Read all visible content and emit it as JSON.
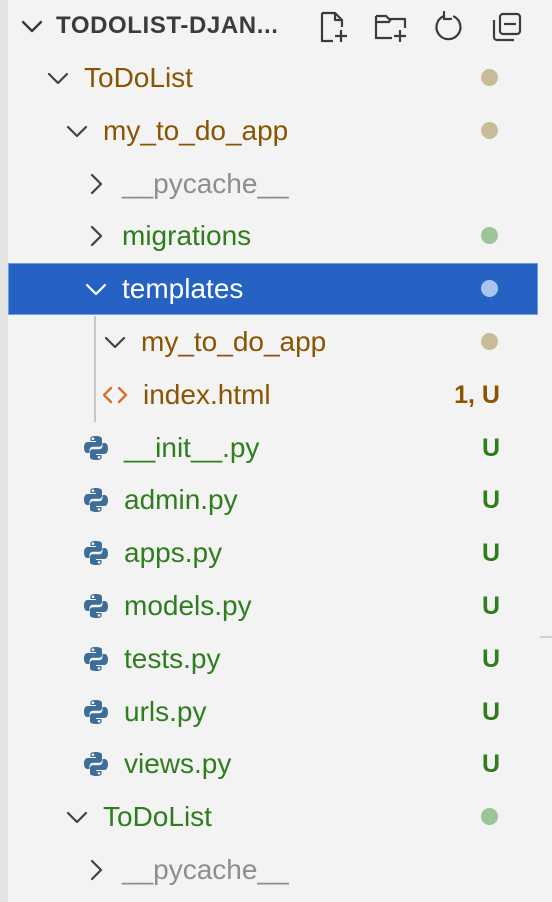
{
  "explorer": {
    "title": "TODOLIST-DJAN...",
    "actions": [
      {
        "name": "new-file",
        "icon": "new-file-icon"
      },
      {
        "name": "new-folder",
        "icon": "new-folder-icon"
      },
      {
        "name": "refresh",
        "icon": "refresh-icon"
      },
      {
        "name": "collapse-all",
        "icon": "collapse-all-icon"
      }
    ]
  },
  "colors": {
    "modified": "#895503",
    "untracked": "#2f7d1f",
    "ignored": "#8e8e8e",
    "selection": "#2662c4",
    "dot_modified": "#c8bb98",
    "dot_untracked": "#9cc499",
    "dot_selected": "#a9c4f0",
    "python_icon": "#3c6e98",
    "html_icon": "#d56f2a"
  },
  "tree": [
    {
      "label": "ToDoList",
      "type": "folder",
      "expanded": true,
      "status": "dot",
      "dot": "modified"
    },
    {
      "label": "my_to_do_app",
      "type": "folder",
      "expanded": true,
      "status": "dot",
      "dot": "modified"
    },
    {
      "label": "__pycache__",
      "type": "folder",
      "expanded": false,
      "status": "none"
    },
    {
      "label": "migrations",
      "type": "folder",
      "expanded": false,
      "status": "dot",
      "dot": "untracked"
    },
    {
      "label": "templates",
      "type": "folder",
      "expanded": true,
      "status": "dot",
      "dot": "selected",
      "selected": true
    },
    {
      "label": "my_to_do_app",
      "type": "folder",
      "expanded": true,
      "status": "dot",
      "dot": "modified"
    },
    {
      "label": "index.html",
      "type": "html",
      "status": "badge",
      "badge": "1, U"
    },
    {
      "label": "__init__.py",
      "type": "python",
      "status": "badge",
      "badge": "U"
    },
    {
      "label": "admin.py",
      "type": "python",
      "status": "badge",
      "badge": "U"
    },
    {
      "label": "apps.py",
      "type": "python",
      "status": "badge",
      "badge": "U"
    },
    {
      "label": "models.py",
      "type": "python",
      "status": "badge",
      "badge": "U"
    },
    {
      "label": "tests.py",
      "type": "python",
      "status": "badge",
      "badge": "U"
    },
    {
      "label": "urls.py",
      "type": "python",
      "status": "badge",
      "badge": "U"
    },
    {
      "label": "views.py",
      "type": "python",
      "status": "badge",
      "badge": "U"
    },
    {
      "label": "ToDoList",
      "type": "folder",
      "expanded": true,
      "status": "dot",
      "dot": "untracked"
    },
    {
      "label": "__pycache__",
      "type": "folder",
      "expanded": false,
      "status": "none"
    }
  ]
}
